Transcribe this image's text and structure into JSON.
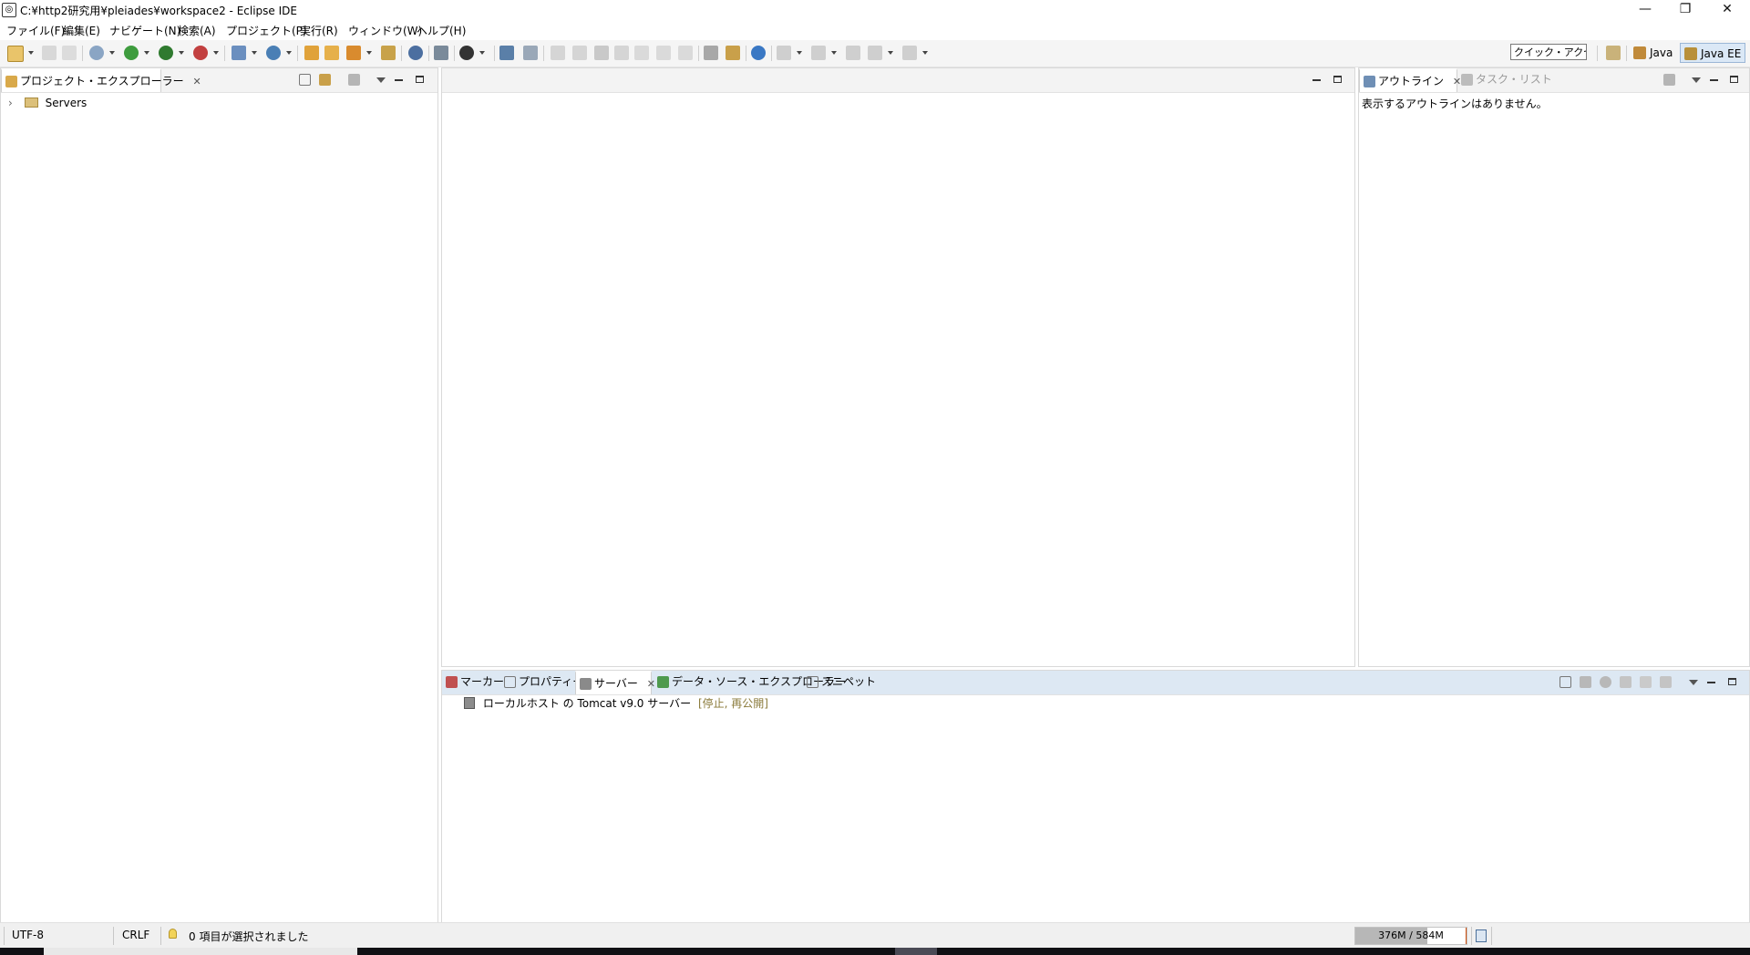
{
  "window": {
    "title": "C:¥http2研究用¥pleiades¥workspace2 - Eclipse IDE",
    "controls": {
      "minimize": "—",
      "restore": "❐",
      "close": "✕"
    }
  },
  "menu": [
    "ファイル(F)",
    "編集(E)",
    "ナビゲート(N)",
    "検索(A)",
    "プロジェクト(P)",
    "実行(R)",
    "ウィンドウ(W)",
    "ヘルプ(H)"
  ],
  "toolbar": {
    "quick_access": "クイック・アクセス",
    "perspectives": [
      {
        "label": "Java",
        "icon": "java-perspective-icon",
        "active": false
      },
      {
        "label": "Java EE",
        "icon": "javaee-perspective-icon",
        "active": true
      }
    ]
  },
  "project_explorer": {
    "tab_label": "プロジェクト・エクスプローラー",
    "close_glyph": "✕",
    "tree": [
      {
        "label": "Servers",
        "expander": "›",
        "icon": "folder-icon"
      }
    ]
  },
  "outline": {
    "tabs": [
      {
        "label": "アウトライン",
        "active": true,
        "icon": "outline-icon"
      },
      {
        "label": "タスク・リスト",
        "active": false,
        "icon": "task-list-icon"
      }
    ],
    "close_glyph": "✕",
    "message": "表示するアウトラインはありません。"
  },
  "bottom_panel": {
    "tabs": [
      {
        "label": "マーカー",
        "active": false,
        "icon": "markers-icon"
      },
      {
        "label": "プロパティー",
        "active": false,
        "icon": "properties-icon"
      },
      {
        "label": "サーバー",
        "active": true,
        "icon": "servers-icon"
      },
      {
        "label": "データ・ソース・エクスプローラー",
        "active": false,
        "icon": "data-source-icon"
      },
      {
        "label": "スニペット",
        "active": false,
        "icon": "snippets-icon"
      }
    ],
    "close_glyph": "✕",
    "servers": [
      {
        "name": "ローカルホスト の Tomcat v9.0 サーバー",
        "state": "[停止, 再公開]"
      }
    ]
  },
  "status": {
    "encoding": "UTF-8",
    "line_delimiter": "CRLF",
    "selection": "0 項目が選択されました",
    "heap": "376M / 584M",
    "heap_used_fraction": 0.644
  },
  "colors": {
    "accent_tab_bg": "#dbe8f6",
    "server_state": "#8a7a3a",
    "heap_marker": "#d05010"
  }
}
